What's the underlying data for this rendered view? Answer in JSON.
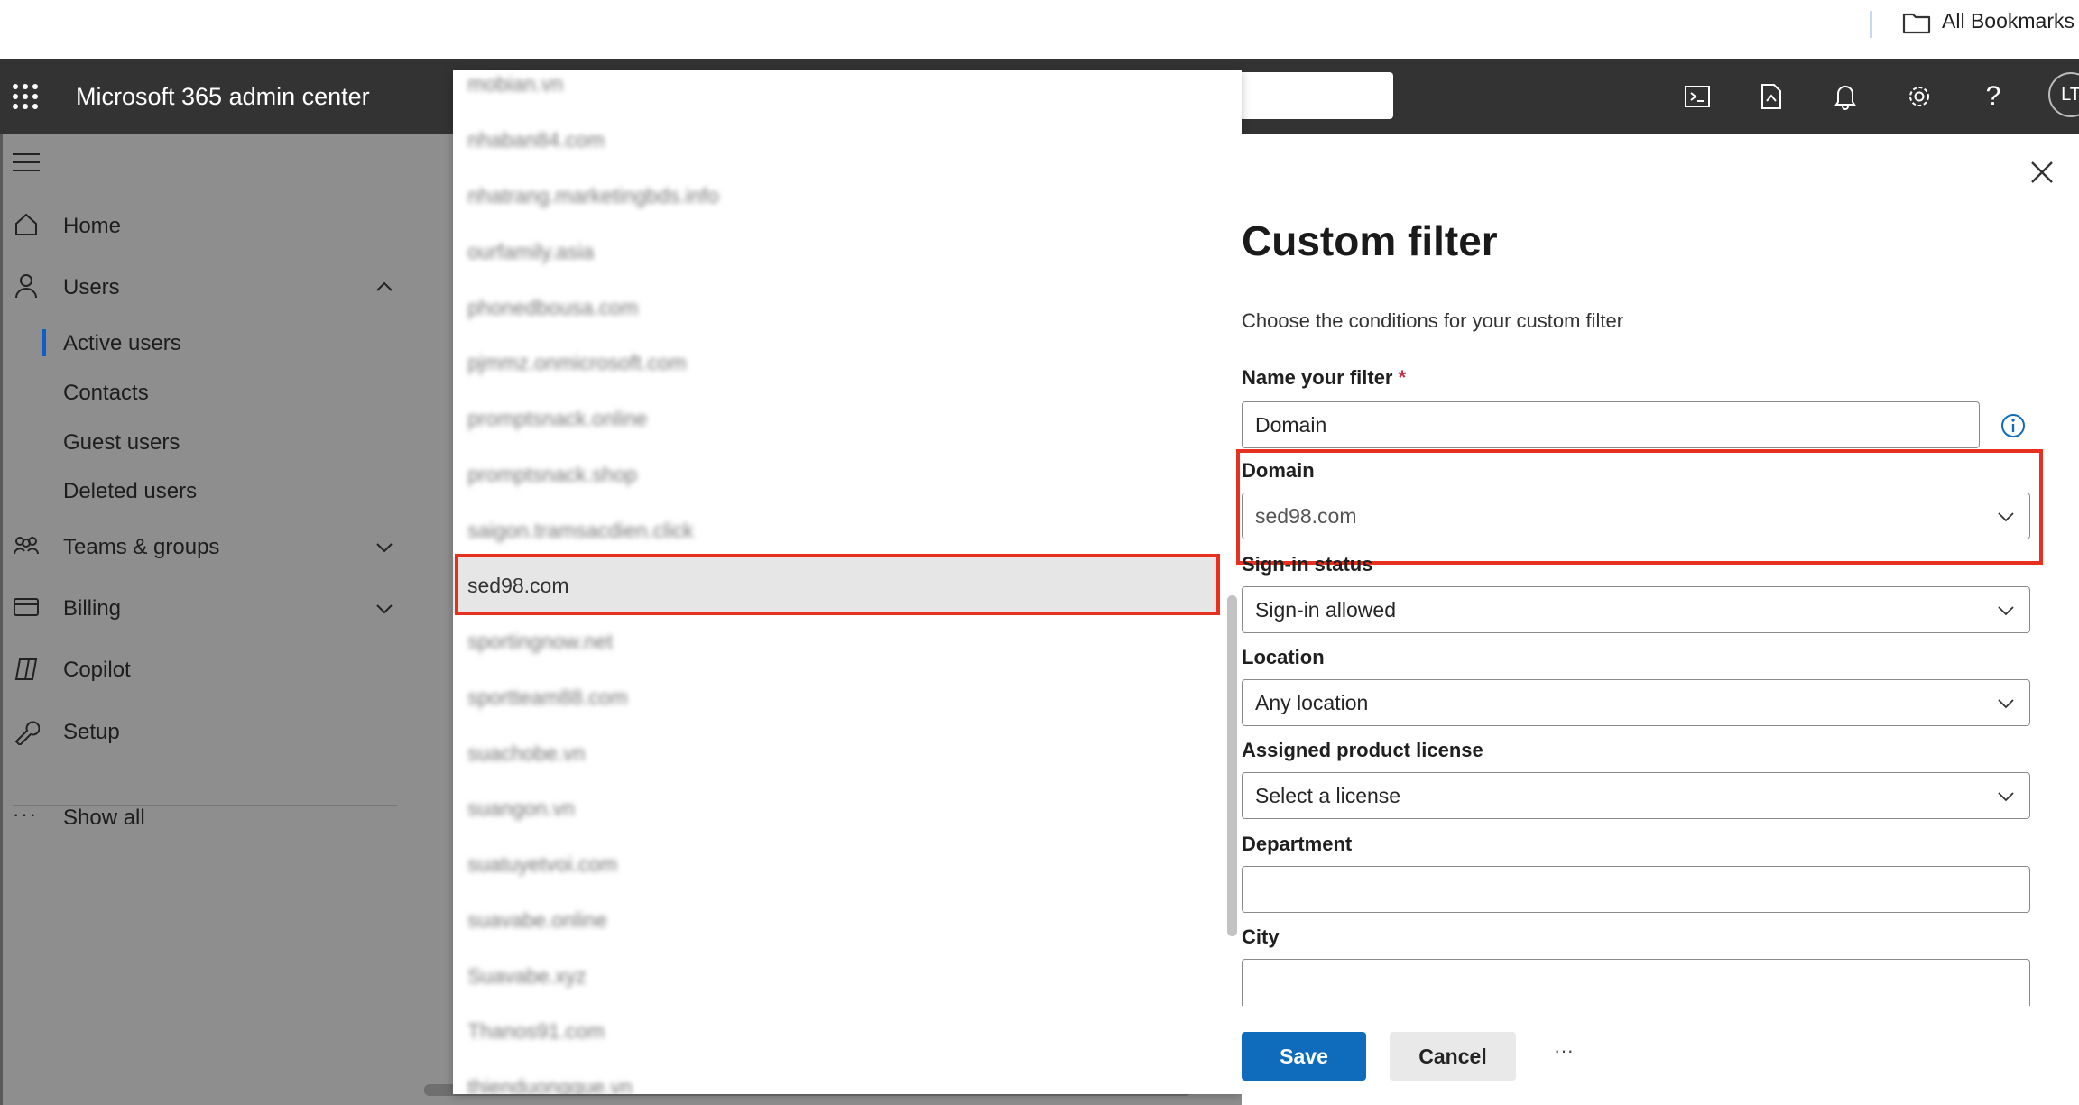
{
  "bookmarks_bar": {
    "label": "All Bookmarks"
  },
  "app_bar": {
    "title": "Microsoft 365 admin center",
    "avatar_initials": "LT"
  },
  "nav": {
    "items": [
      {
        "label": "Home"
      },
      {
        "label": "Users"
      },
      {
        "label": "Active users"
      },
      {
        "label": "Contacts"
      },
      {
        "label": "Guest users"
      },
      {
        "label": "Deleted users"
      },
      {
        "label": "Teams & groups"
      },
      {
        "label": "Billing"
      },
      {
        "label": "Copilot"
      },
      {
        "label": "Setup"
      },
      {
        "label": "Show all"
      }
    ]
  },
  "domain_list": {
    "items": [
      "mobian.vn",
      "nhaban84.com",
      "nhatrang.marketingbds.info",
      "ourfamily.asia",
      "phonedbousa.com",
      "pjmmz.onmicrosoft.com",
      "promptsnack.online",
      "promptsnack.shop",
      "saigon.tramsacdien.click",
      "sed98.com",
      "sportingnow.net",
      "sportteam88.com",
      "suachobe.vn",
      "suangon.vn",
      "suatuyetvoi.com",
      "suavabe.online",
      "Suavabe.xyz",
      "Thanos91.com",
      "thienduongque.vn"
    ],
    "selected": "sed98.com"
  },
  "panel": {
    "title": "Custom filter",
    "description": "Choose the conditions for your custom filter",
    "name_label": "Name your filter",
    "required_mark": "*",
    "name_value": "Domain",
    "domain_label": "Domain",
    "domain_value": "sed98.com",
    "signin_label": "Sign-in status",
    "signin_value": "Sign-in allowed",
    "location_label": "Location",
    "location_value": "Any location",
    "license_label": "Assigned product license",
    "license_value": "Select a license",
    "department_label": "Department",
    "department_value": "",
    "city_label": "City",
    "city_value": "",
    "save_label": "Save",
    "cancel_label": "Cancel",
    "more_label": "···"
  },
  "colors": {
    "accent": "#0f6cbd",
    "highlight": "#e8301e",
    "app_bar": "#333333"
  }
}
